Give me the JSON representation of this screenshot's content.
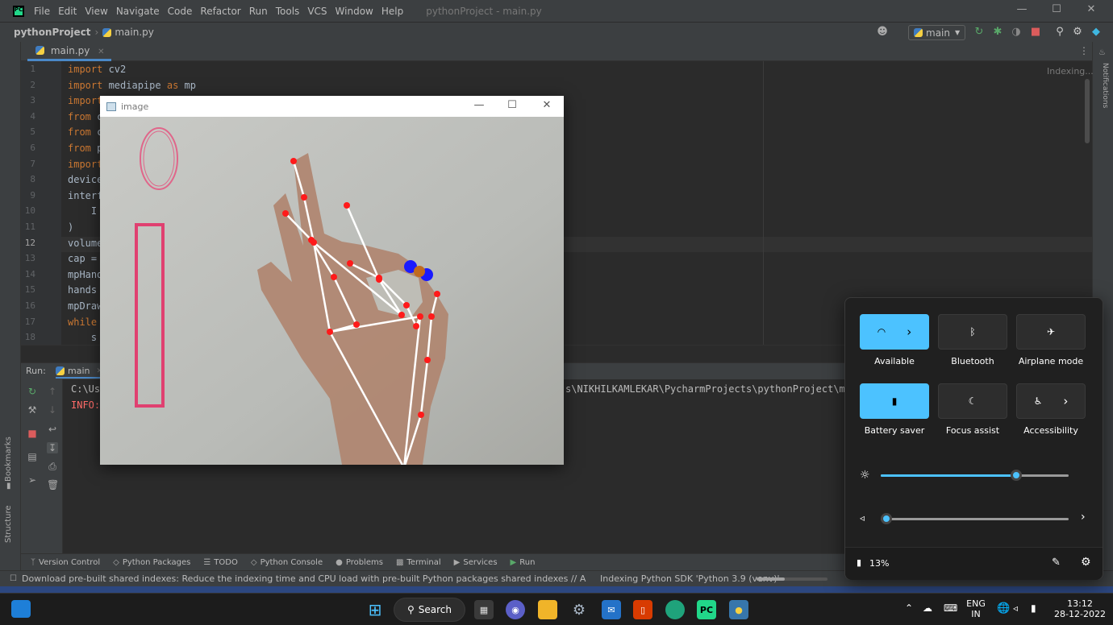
{
  "ide": {
    "menu": [
      "File",
      "Edit",
      "View",
      "Navigate",
      "Code",
      "Refactor",
      "Run",
      "Tools",
      "VCS",
      "Window",
      "Help"
    ],
    "window_title": "pythonProject - main.py",
    "project": "pythonProject",
    "file": "main.py",
    "branch": "main",
    "tab": "main.py",
    "indexing_label": "Indexing...",
    "line_numbers": [
      "1",
      "2",
      "3",
      "4",
      "5",
      "6",
      "7",
      "8",
      "9",
      "10",
      "11",
      "12",
      "13",
      "14",
      "15",
      "16",
      "17",
      "18"
    ],
    "code_lines": [
      {
        "kw": "import",
        "rest": " cv2"
      },
      {
        "kw": "import",
        "rest": " mediapipe ",
        "kw2": "as",
        "rest2": " mp"
      },
      {
        "kw": "import",
        "rest": ""
      },
      {
        "kw": "from",
        "rest": " c"
      },
      {
        "kw": "from",
        "rest": " c"
      },
      {
        "kw": "from",
        "rest": " p"
      },
      {
        "kw": "import",
        "rest": ""
      },
      {
        "kw": "",
        "rest": "device"
      },
      {
        "kw": "",
        "rest": "interf"
      },
      {
        "kw": "",
        "rest": "    I"
      },
      {
        "kw": "",
        "rest": ")"
      },
      {
        "kw": "",
        "rest": "volume"
      },
      {
        "kw": "",
        "rest": "cap = "
      },
      {
        "kw": "",
        "rest": "mpHand"
      },
      {
        "kw": "",
        "rest": "hands "
      },
      {
        "kw": "",
        "rest": "mpDraw"
      },
      {
        "kw": "while",
        "rest": " "
      },
      {
        "kw": "",
        "rest": "    s"
      }
    ],
    "run_label": "Run:",
    "run_config": "main",
    "console": {
      "line1_left": "C:\\Us",
      "line1_right": "s\\NIKHILKAMLEKAR\\PycharmProjects\\pythonProject\\ma",
      "line2": "INFO:"
    },
    "tool_windows": [
      "Version Control",
      "Python Packages",
      "TODO",
      "Python Console",
      "Problems",
      "Terminal",
      "Services",
      "Run"
    ],
    "left_strip": [
      "Bookmarks",
      "Structure"
    ],
    "right_strip": "Notifications",
    "status_message": "Download pre-built shared indexes: Reduce the indexing time and CPU load with pre-built Python packages shared indexes // Alway... (7 minutes a",
    "status_task": "Indexing Python SDK 'Python 3.9 (venv)'",
    "indexing_progress": 0.4
  },
  "cv_window": {
    "title": "image",
    "volume_level": 0.0
  },
  "quick_settings": {
    "tiles": [
      {
        "label": "Available",
        "icon": "wifi-icon",
        "on": true,
        "chevron": true
      },
      {
        "label": "Bluetooth",
        "icon": "bluetooth-icon",
        "on": false,
        "chevron": false
      },
      {
        "label": "Airplane mode",
        "icon": "airplane-icon",
        "on": false,
        "chevron": false
      },
      {
        "label": "Battery saver",
        "icon": "battery-saver-icon",
        "on": true,
        "chevron": false
      },
      {
        "label": "Focus assist",
        "icon": "moon-icon",
        "on": false,
        "chevron": false
      },
      {
        "label": "Accessibility",
        "icon": "accessibility-icon",
        "on": false,
        "chevron": true
      }
    ],
    "brightness": 0.72,
    "volume": 0.03,
    "battery": "13%"
  },
  "taskbar": {
    "search_label": "Search",
    "lang_top": "ENG",
    "lang_bottom": "IN",
    "time": "13:12",
    "date": "28-12-2022"
  },
  "colors": {
    "accent": "#4cc2ff",
    "keyword": "#cc7832",
    "error": "#ff6b68"
  }
}
